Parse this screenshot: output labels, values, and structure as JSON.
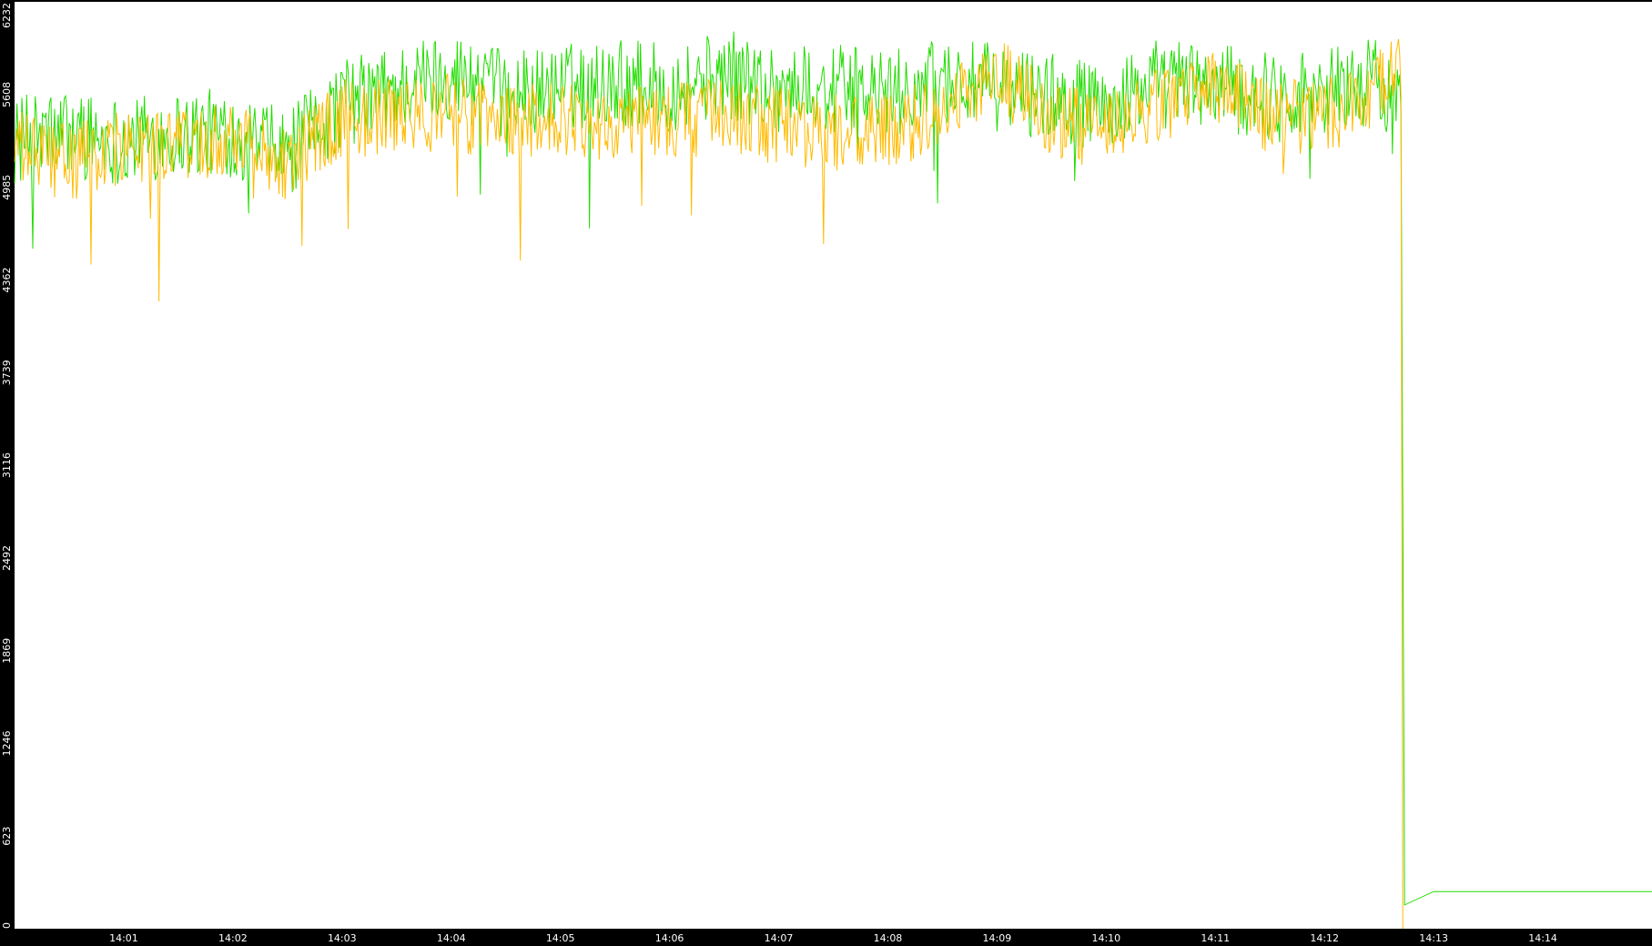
{
  "chart_data": {
    "type": "line",
    "title": "",
    "xlabel": "",
    "ylabel": "",
    "background_color": "#000000",
    "plot_background_color": "#ffffff",
    "grid": false,
    "legend": "none",
    "x_unit": "minutes",
    "xlim": [
      "14:00",
      "14:15"
    ],
    "ylim": [
      0,
      6232
    ],
    "y_ticks": [
      0,
      623,
      1246,
      1869,
      2492,
      3116,
      3739,
      4362,
      4985,
      5608,
      6232
    ],
    "y_tick_labels": [
      "0",
      "623",
      "1246",
      "1869",
      "2492",
      "3116",
      "3739",
      "4362",
      "4985",
      "5608",
      "6232"
    ],
    "x_ticks": [
      "14:01",
      "14:02",
      "14:03",
      "14:04",
      "14:05",
      "14:06",
      "14:07",
      "14:08",
      "14:09",
      "14:10",
      "14:11",
      "14:12",
      "14:13",
      "14:14"
    ],
    "x_tick_labels": [
      "14:01",
      "14:02",
      "14:03",
      "14:04",
      "14:05",
      "14:06",
      "14:07",
      "14:08",
      "14:09",
      "14:10",
      "14:11",
      "14:12",
      "14:13",
      "14:14"
    ],
    "series": [
      {
        "color": "#22dd00",
        "x": [
          "14:00",
          "14:00:30",
          "14:01",
          "14:01:30",
          "14:02",
          "14:02:30",
          "14:03",
          "14:03:30",
          "14:04",
          "14:04:30",
          "14:05",
          "14:05:30",
          "14:06",
          "14:06:30",
          "14:07",
          "14:07:30",
          "14:08",
          "14:08:30",
          "14:09",
          "14:09:30",
          "14:10",
          "14:10:30",
          "14:11",
          "14:11:30",
          "14:12",
          "14:12:30",
          "14:12:42",
          "14:12:43",
          "14:12:44",
          "14:13",
          "14:14",
          "14:15"
        ],
        "y": [
          5300,
          5350,
          5300,
          5350,
          5350,
          5200,
          5550,
          5650,
          5750,
          5600,
          5650,
          5700,
          5650,
          5750,
          5650,
          5650,
          5600,
          5700,
          5650,
          5600,
          5500,
          5700,
          5650,
          5600,
          5650,
          5700,
          5500,
          2850,
          160,
          250,
          250,
          250
        ]
      },
      {
        "color": "#ffbb00",
        "x": [
          "14:00",
          "14:00:30",
          "14:01",
          "14:01:30",
          "14:02",
          "14:02:30",
          "14:03",
          "14:03:30",
          "14:04",
          "14:04:30",
          "14:05",
          "14:05:30",
          "14:06",
          "14:06:30",
          "14:07",
          "14:07:30",
          "14:08",
          "14:08:30",
          "14:09",
          "14:09:30",
          "14:10",
          "14:10:30",
          "14:11",
          "14:11:30",
          "14:12",
          "14:12:30",
          "14:12:40",
          "14:12:42",
          "14:12:43"
        ],
        "y": [
          5250,
          5150,
          5250,
          5250,
          5350,
          5150,
          5450,
          5450,
          5500,
          5400,
          5450,
          5400,
          5450,
          5450,
          5400,
          5350,
          5350,
          5500,
          5750,
          5450,
          5350,
          5550,
          5650,
          5450,
          5450,
          5650,
          5900,
          5600,
          0
        ]
      }
    ]
  }
}
